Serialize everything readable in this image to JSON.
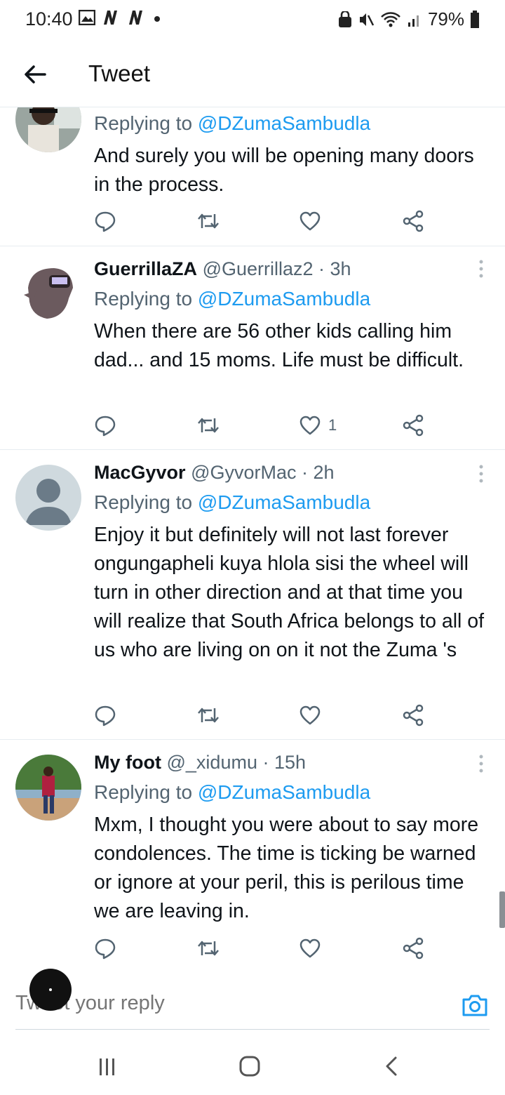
{
  "status_bar": {
    "time": "10:40",
    "left_icons": [
      "image-icon",
      "netflix-icon",
      "netflix-icon",
      "dot-icon"
    ],
    "right_icons": [
      "lock-icon",
      "mute-icon",
      "wifi-icon",
      "signal-icon"
    ],
    "battery": "79%"
  },
  "header": {
    "title": "Tweet",
    "back_icon": "arrow-left-icon"
  },
  "tweets": [
    {
      "name": "",
      "handle": "",
      "time": "",
      "replying_prefix": "Replying to ",
      "replying_handle": "@DZumaSambudla",
      "text": "And surely you will be opening many doors in the process.",
      "likes": ""
    },
    {
      "name": "GuerrillaZA",
      "handle": "@Guerrillaz2",
      "time": "· 3h",
      "replying_prefix": "Replying to ",
      "replying_handle": "@DZumaSambudla",
      "text": "When there are 56 other kids calling him dad... and 15 moms. Life must be difficult.",
      "likes": "1"
    },
    {
      "name": "MacGyvor",
      "handle": "@GyvorMac",
      "time": "· 2h",
      "replying_prefix": "Replying to ",
      "replying_handle": "@DZumaSambudla",
      "text": "Enjoy it but definitely will not last forever ongungapheli kuya hlola sisi the wheel will turn in other direction and at that time you will realize that South Africa belongs to all of us who are living on on it not the Zuma 's",
      "likes": ""
    },
    {
      "name": "My foot",
      "handle": "@_xidumu",
      "time": "· 15h",
      "replying_prefix": "Replying to ",
      "replying_handle": "@DZumaSambudla",
      "text": "Mxm, I thought you were about to say more condolences. The time is ticking be warned or ignore at your peril, this is perilous time we are leaving in.",
      "likes": ""
    }
  ],
  "composer": {
    "placeholder": "Tweet your reply",
    "camera_icon": "camera-icon"
  },
  "nav_bar": {
    "recents_icon": "recents-icon",
    "home_icon": "home-icon",
    "back_icon": "back-icon"
  },
  "colors": {
    "link": "#1d9bf0",
    "muted": "#536471",
    "text": "#0f1419",
    "divider": "#e6ecf0"
  }
}
